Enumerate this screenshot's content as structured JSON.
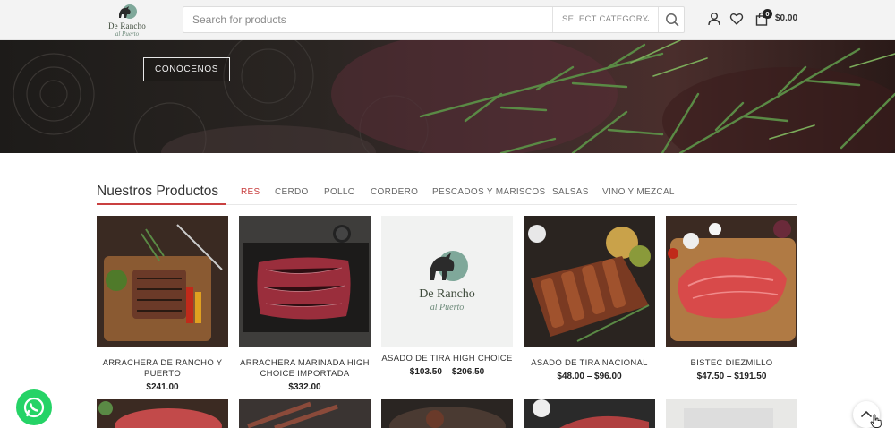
{
  "header": {
    "logo": {
      "brand": "De Rancho",
      "script": "al Puerto"
    },
    "search": {
      "placeholder": "Search for products",
      "category_label": "SELECT CATEGORY"
    },
    "cart": {
      "count": "0",
      "total": "$0.00"
    },
    "icons": [
      "search-icon",
      "user-icon",
      "heart-icon",
      "shopping-bag-icon",
      "chevron-down-icon"
    ]
  },
  "hero": {
    "button_label": "CONÓCENOS"
  },
  "products": {
    "title": "Nuestros Productos",
    "tabs": [
      "RES",
      "CERDO",
      "POLLO",
      "CORDERO",
      "PESCADOS Y MARISCOS",
      "SALSAS",
      "VINO Y MEZCAL"
    ],
    "active_tab": "RES",
    "items": [
      {
        "name": "ARRACHERA DE RANCHO Y PUERTO",
        "price": "$241.00"
      },
      {
        "name": "ARRACHERA MARINADA HIGH CHOICE IMPORTADA",
        "price": "$332.00"
      },
      {
        "name": "ASADO DE TIRA HIGH CHOICE",
        "price": "$103.50 – $206.50",
        "image_logo": {
          "brand": "De Rancho",
          "script": "al Puerto"
        }
      },
      {
        "name": "ASADO DE TIRA NACIONAL",
        "price": "$48.00 – $96.00"
      },
      {
        "name": "BISTEC DIEZMILLO",
        "price": "$47.50 – $191.50"
      }
    ]
  },
  "colors": {
    "accent": "#c94040",
    "whatsapp": "#25d366",
    "header_bg": "#f3f3f3"
  },
  "floating": {
    "icons": [
      "whatsapp-icon",
      "chevron-up-icon"
    ]
  }
}
